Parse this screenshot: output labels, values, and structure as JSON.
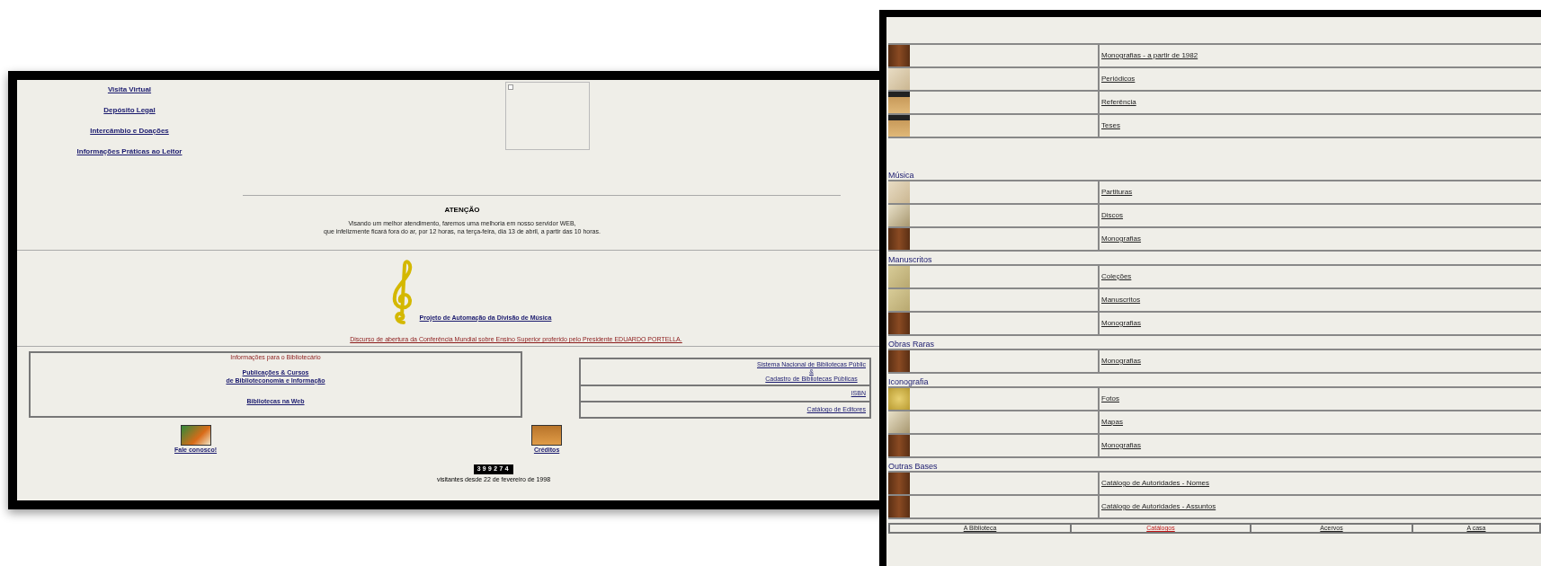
{
  "left_page": {
    "nav_links": [
      "Visita Virtual",
      "Depósito Legal",
      "Intercâmbio e Doações",
      "Informações Práticas ao Leitor"
    ],
    "notice": {
      "title": "ATENÇÃO",
      "lines": [
        "Visando um melhor atendimento, faremos uma melhoria em nosso servidor WEB,",
        "que infelizmente ficará fora do ar, por 12 horas, na terça-feira, dia 13 de abril, a partir das 10 horas."
      ]
    },
    "music_link": "Projeto de Automação da Divisão de Música",
    "speech_link": "Discurso de abertura da Conferência Mundial sobre Ensino Superior proferido pelo Presidente EDUARDO PORTELLA.",
    "librarian_box": {
      "title": "Informações para o Bibliotecário",
      "links": [
        [
          "Publicações & Cursos",
          "de Biblioteconomia e Informação"
        ],
        [
          "Bibliotecas na Web"
        ]
      ]
    },
    "side_box": [
      [
        "Sistema Nacional de Bibliotecas Públic",
        "&",
        "Cadastro de Bibliotecas Públicas"
      ],
      [
        "ISBN"
      ],
      [
        "Catálogo de Editores"
      ]
    ],
    "contact_link": "Fale conosco!",
    "credits_link": "Créditos",
    "counter": "399274",
    "visitors": "visitantes desde 22 de fevereiro de 1998"
  },
  "right_page": {
    "sections": [
      {
        "rows": [
          {
            "kind": "book",
            "label": "Monografias - a partir de 1982"
          },
          {
            "kind": "paper",
            "label": "Periódicos"
          },
          {
            "kind": "shelf",
            "label": "Referência"
          },
          {
            "kind": "shelf",
            "label": "Teses"
          }
        ]
      },
      {
        "heading": "Música",
        "rows": [
          {
            "kind": "paper",
            "label": "Partituras"
          },
          {
            "kind": "disc",
            "label": "Discos"
          },
          {
            "kind": "book",
            "label": "Monografias"
          }
        ]
      },
      {
        "heading": "Manuscritos",
        "rows": [
          {
            "kind": "manuscript",
            "label": "Coleções"
          },
          {
            "kind": "manuscript",
            "label": "Manuscritos"
          },
          {
            "kind": "book",
            "label": "Monografias"
          }
        ]
      },
      {
        "heading": "Obras Raras",
        "rows": [
          {
            "kind": "book",
            "label": "Monografias"
          }
        ]
      },
      {
        "heading": "Iconografia",
        "rows": [
          {
            "kind": "photo",
            "label": "Fotos"
          },
          {
            "kind": "disc",
            "label": "Mapas"
          },
          {
            "kind": "book",
            "label": "Monografias"
          }
        ]
      },
      {
        "heading": "Outras Bases",
        "rows": [
          {
            "kind": "book",
            "label": "Catálogo de Autoridades - Nomes"
          },
          {
            "kind": "book",
            "label": "Catálogo de Autoridades - Assuntos"
          }
        ]
      }
    ],
    "nav": [
      {
        "label": "A Biblioteca",
        "selected": false
      },
      {
        "label": "Catálogos",
        "selected": true
      },
      {
        "label": "Acervos",
        "selected": false
      },
      {
        "label": "A casa",
        "selected": false
      }
    ]
  }
}
